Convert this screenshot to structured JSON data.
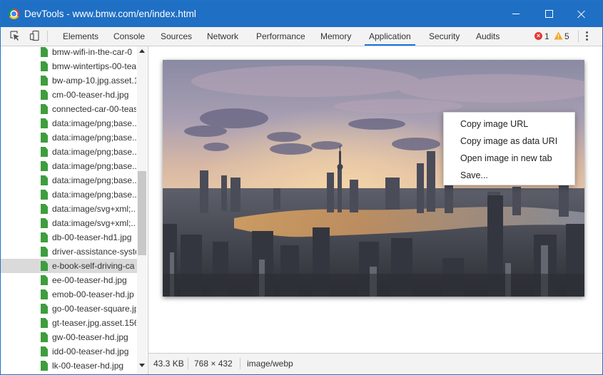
{
  "window": {
    "title": "DevTools - www.bmw.com/en/index.html"
  },
  "toolbar": {
    "tabs": [
      "Elements",
      "Console",
      "Sources",
      "Network",
      "Performance",
      "Memory",
      "Application",
      "Security",
      "Audits"
    ],
    "active_tab": "Application",
    "error_count": "1",
    "warning_count": "5",
    "error_icon": "error-circle-icon",
    "warning_icon": "warning-triangle-icon"
  },
  "sidebar": {
    "items": [
      {
        "label": "bmw-wifi-in-the-car-0"
      },
      {
        "label": "bmw-wintertips-00-tea"
      },
      {
        "label": "bw-amp-10.jpg.asset.1"
      },
      {
        "label": "cm-00-teaser-hd.jpg"
      },
      {
        "label": "connected-car-00-teas"
      },
      {
        "label": "data:image/png;base..."
      },
      {
        "label": "data:image/png;base..."
      },
      {
        "label": "data:image/png;base..."
      },
      {
        "label": "data:image/png;base..."
      },
      {
        "label": "data:image/png;base..."
      },
      {
        "label": "data:image/png;base..."
      },
      {
        "label": "data:image/svg+xml;..."
      },
      {
        "label": "data:image/svg+xml;..."
      },
      {
        "label": "db-00-teaser-hd1.jpg"
      },
      {
        "label": "driver-assistance-syste"
      },
      {
        "label": "e-book-self-driving-ca"
      },
      {
        "label": "ee-00-teaser-hd.jpg"
      },
      {
        "label": "emob-00-teaser-hd.jp"
      },
      {
        "label": "go-00-teaser-square.jp"
      },
      {
        "label": "gt-teaser.jpg.asset.156"
      },
      {
        "label": "gw-00-teaser-hd.jpg"
      },
      {
        "label": "idd-00-teaser-hd.jpg"
      },
      {
        "label": "lk-00-teaser-hd.jpg"
      }
    ],
    "selected_index": 15
  },
  "context_menu": {
    "items": [
      "Copy image URL",
      "Copy image as data URI",
      "Open image in new tab",
      "Save..."
    ]
  },
  "status": {
    "size": "43.3 KB",
    "dimensions": "768 × 432",
    "mime": "image/webp"
  },
  "colors": {
    "titlebar": "#1f6fc4",
    "tab_underline": "#1a73e8",
    "file_icon": "#3d9e3d",
    "error": "#e53935",
    "warning": "#f5a623"
  }
}
